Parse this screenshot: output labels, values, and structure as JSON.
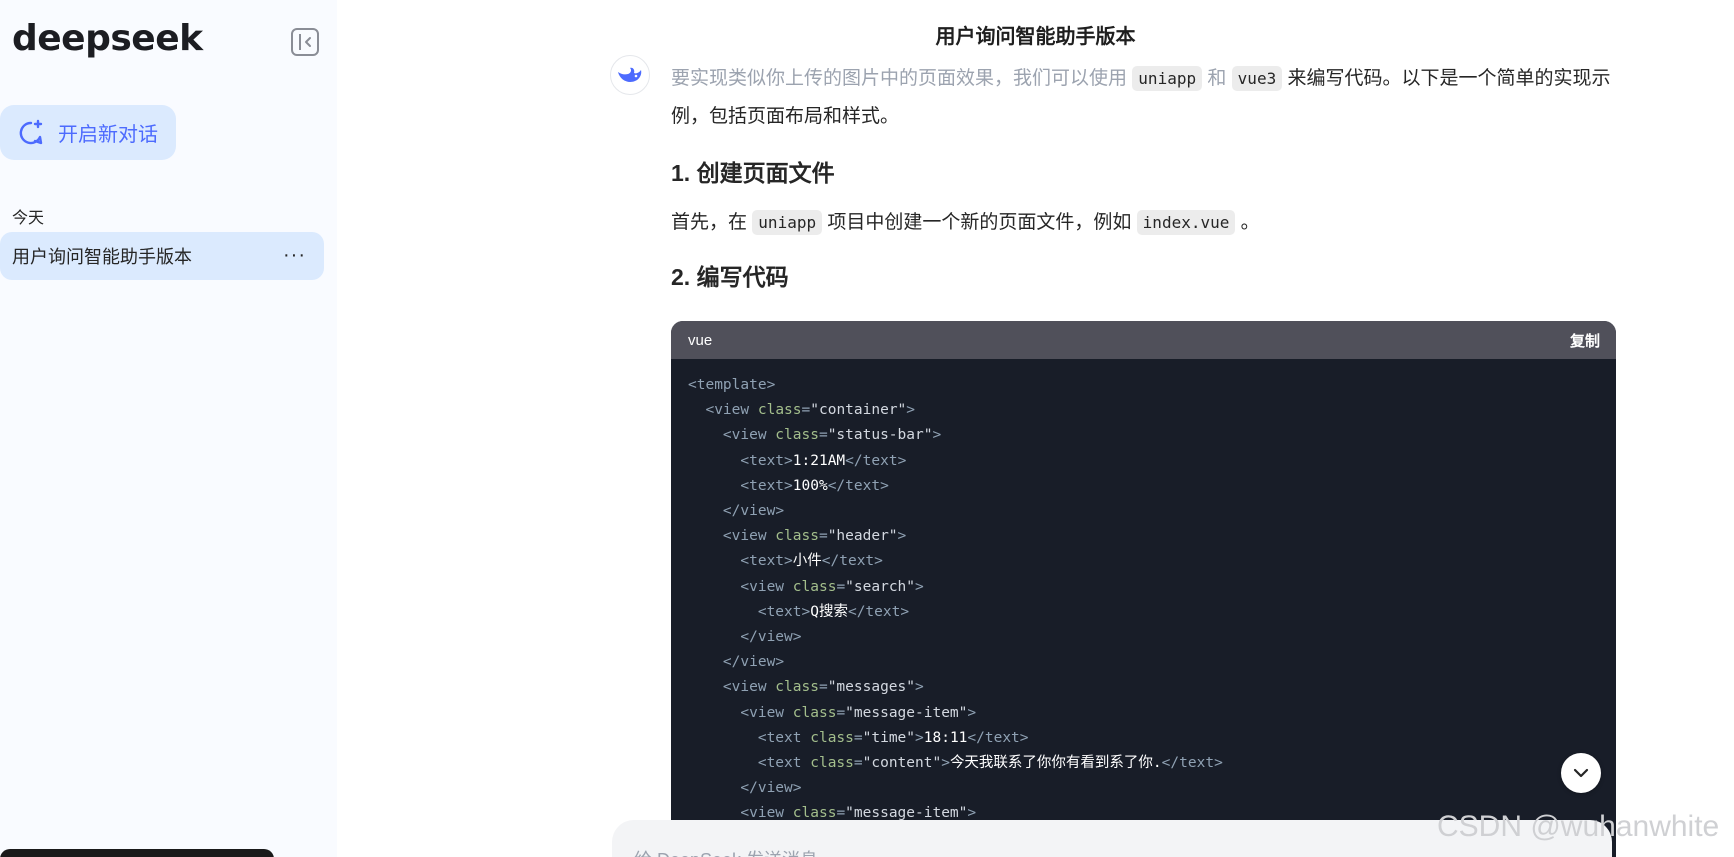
{
  "sidebar": {
    "logo": "deepseek",
    "new_chat_label": "开启新对话",
    "section_today": "今天",
    "conversations": [
      {
        "title": "用户询问智能助手版本",
        "more": "···"
      }
    ]
  },
  "main": {
    "title": "用户询问智能助手版本",
    "intro": {
      "part1": "要实现类似你上传的图片中的页面效果，我们可以使用",
      "code1": "uniapp",
      "part2": "和",
      "code2": "vue3",
      "part3": "来编写代码。以下是一个简单的实现示例，包括页面布局和样式。"
    },
    "step1_heading": "1. 创建页面文件",
    "step1_text": {
      "part1": "首先，在",
      "code1": "uniapp",
      "part2": "项目中创建一个新的页面文件，例如",
      "code2": "index.vue",
      "part3": "。"
    },
    "step2_heading": "2. 编写代码",
    "codeblock": {
      "language": "vue",
      "copy_label": "复制",
      "lines": [
        "<template>",
        "  <view class=\"container\">",
        "    <view class=\"status-bar\">",
        "      <text>1:21AM</text>",
        "      <text>100%</text>",
        "    </view>",
        "    <view class=\"header\">",
        "      <text>小件</text>",
        "      <view class=\"search\">",
        "        <text>Q搜索</text>",
        "      </view>",
        "    </view>",
        "    <view class=\"messages\">",
        "      <view class=\"message-item\">",
        "        <text class=\"time\">18:11</text>",
        "        <text class=\"content\">今天我联系了你你有看到系了你.</text>",
        "      </view>",
        "      <view class=\"message-item\">"
      ]
    },
    "input_placeholder": "给 DeepSeek 发送消息",
    "watermark": "CSDN @wuhanwhite"
  },
  "colors": {
    "accent": "#4d6bfe",
    "sidebar_bg": "#f9fbff",
    "selected_bg": "#dbeafe",
    "code_bg": "#181d28",
    "code_header_bg": "#50505a"
  }
}
